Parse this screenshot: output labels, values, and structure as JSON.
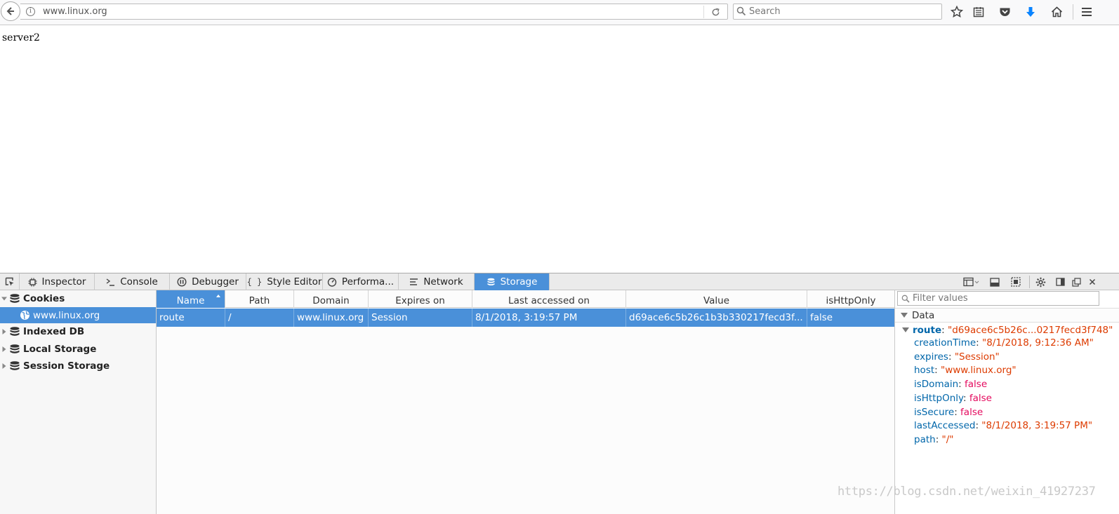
{
  "browser": {
    "url": "www.linux.org",
    "search_placeholder": "Search",
    "icons": [
      "back-arrow-icon",
      "info-icon",
      "reload-icon",
      "search-icon",
      "bookmark-star-icon",
      "reading-list-icon",
      "pocket-icon",
      "downloads-icon",
      "home-icon",
      "menu-icon"
    ]
  },
  "page": {
    "text": "server2"
  },
  "devtools": {
    "tabs": [
      {
        "label": "Inspector",
        "icon": "inspector-icon"
      },
      {
        "label": "Console",
        "icon": "console-icon"
      },
      {
        "label": "Debugger",
        "icon": "debugger-icon"
      },
      {
        "label": "Style Editor",
        "icon": "style-editor-icon"
      },
      {
        "label": "Performa...",
        "icon": "performance-icon"
      },
      {
        "label": "Network",
        "icon": "network-icon"
      },
      {
        "label": "Storage",
        "icon": "storage-icon",
        "active": true
      }
    ],
    "right_icons": [
      "responsive-design-icon",
      "split-console-icon",
      "screenshot-icon",
      "settings-icon",
      "dock-side-icon",
      "undock-icon",
      "close-icon"
    ]
  },
  "storage": {
    "tree": {
      "cookies": {
        "label": "Cookies",
        "expanded": true
      },
      "cookies_host": "www.linux.org",
      "indexed_db": "Indexed DB",
      "local_storage": "Local Storage",
      "session_storage": "Session Storage"
    },
    "columns": [
      "Name",
      "Path",
      "Domain",
      "Expires on",
      "Last accessed on",
      "Value",
      "isHttpOnly"
    ],
    "sorted_column": "Name",
    "rows": [
      {
        "name": "route",
        "path": "/",
        "domain": "www.linux.org",
        "expires": "Session",
        "last_accessed": "8/1/2018, 3:19:57 PM",
        "value": "d69ace6c5b26c1b3b330217fecd3f...",
        "is_http_only": "false"
      }
    ],
    "details": {
      "filter_placeholder": "Filter values",
      "section": "Data",
      "root_key": "route",
      "root_value": "\"d69ace6c5b26c...0217fecd3f748\"",
      "props": [
        {
          "key": "creationTime",
          "value": "\"8/1/2018, 9:12:36 AM\"",
          "kind": "string"
        },
        {
          "key": "expires",
          "value": "\"Session\"",
          "kind": "string"
        },
        {
          "key": "host",
          "value": "\"www.linux.org\"",
          "kind": "string"
        },
        {
          "key": "isDomain",
          "value": "false",
          "kind": "bool"
        },
        {
          "key": "isHttpOnly",
          "value": "false",
          "kind": "bool"
        },
        {
          "key": "isSecure",
          "value": "false",
          "kind": "bool"
        },
        {
          "key": "lastAccessed",
          "value": "\"8/1/2018, 3:19:57 PM\"",
          "kind": "string"
        },
        {
          "key": "path",
          "value": "\"/\"",
          "kind": "string"
        }
      ]
    }
  },
  "watermark": "https://blog.csdn.net/weixin_41927237",
  "colors": {
    "accent": "#4a90d9",
    "key": "#0066aa",
    "string": "#dd3b00",
    "boolean": "#e40a5e",
    "download": "#0a84ff"
  }
}
